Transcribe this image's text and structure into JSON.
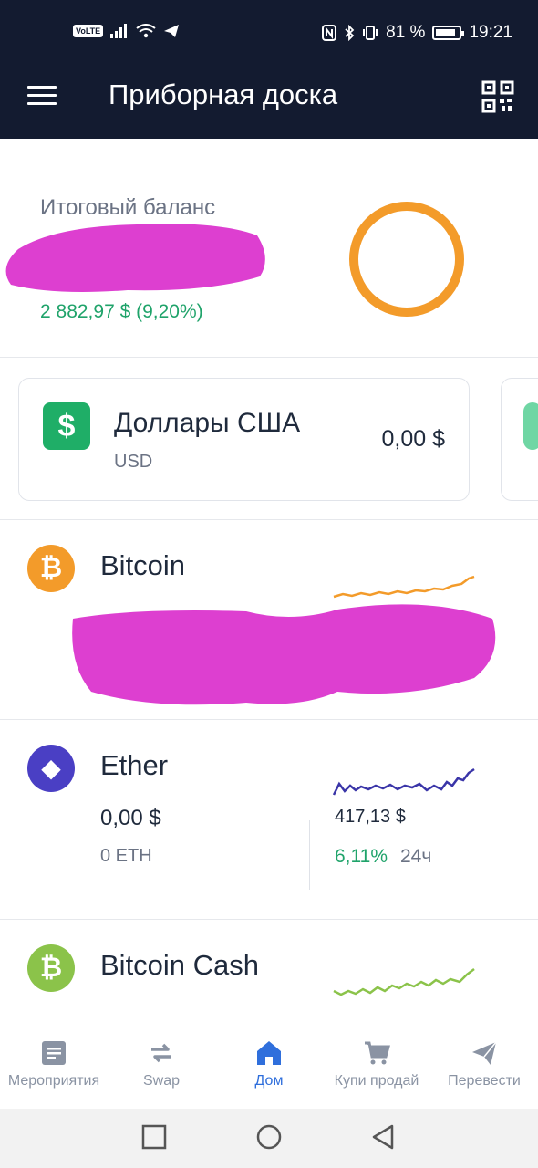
{
  "status_bar": {
    "volte": "VoLTE",
    "battery_pct": "81 %",
    "time": "19:21"
  },
  "header": {
    "title": "Приборная доска",
    "icons": [
      "menu-icon",
      "qr-code-icon"
    ]
  },
  "balance": {
    "label": "Итоговый баланс",
    "change": "2 882,97 $ (9,20%)",
    "ring_color": "#f39b2a"
  },
  "cards": [
    {
      "icon": "dollar-icon",
      "icon_glyph": "$",
      "name": "Доллары США",
      "code": "USD",
      "amount": "0,00 $",
      "color": "#1fae67"
    }
  ],
  "assets": [
    {
      "name": "Bitcoin",
      "coin_glyph": "₿",
      "color": "#f39b2a",
      "fiat_balance": "",
      "crypto_balance": "",
      "price": "",
      "change": "",
      "period": ""
    },
    {
      "name": "Ether",
      "coin_glyph": "◆",
      "color": "#4a3fc4",
      "fiat_balance": "0,00 $",
      "crypto_balance": "0 ETH",
      "price": "417,13 $",
      "change": "6,11%",
      "period": "24ч"
    },
    {
      "name": "Bitcoin Cash",
      "coin_glyph": "₿",
      "color": "#8bc34a",
      "fiat_balance": "",
      "crypto_balance": "",
      "price": "",
      "change": "",
      "period": ""
    }
  ],
  "bottom_nav": [
    {
      "label": "Мероприятия",
      "icon": "events-icon",
      "active": false
    },
    {
      "label": "Swap",
      "icon": "swap-icon",
      "active": false
    },
    {
      "label": "Дом",
      "icon": "home-icon",
      "active": true
    },
    {
      "label": "Купи продай",
      "icon": "cart-icon",
      "active": false
    },
    {
      "label": "Перевести",
      "icon": "send-icon",
      "active": false
    }
  ],
  "accent_color": "#2f6fdc",
  "positive_color": "#1fa36a"
}
